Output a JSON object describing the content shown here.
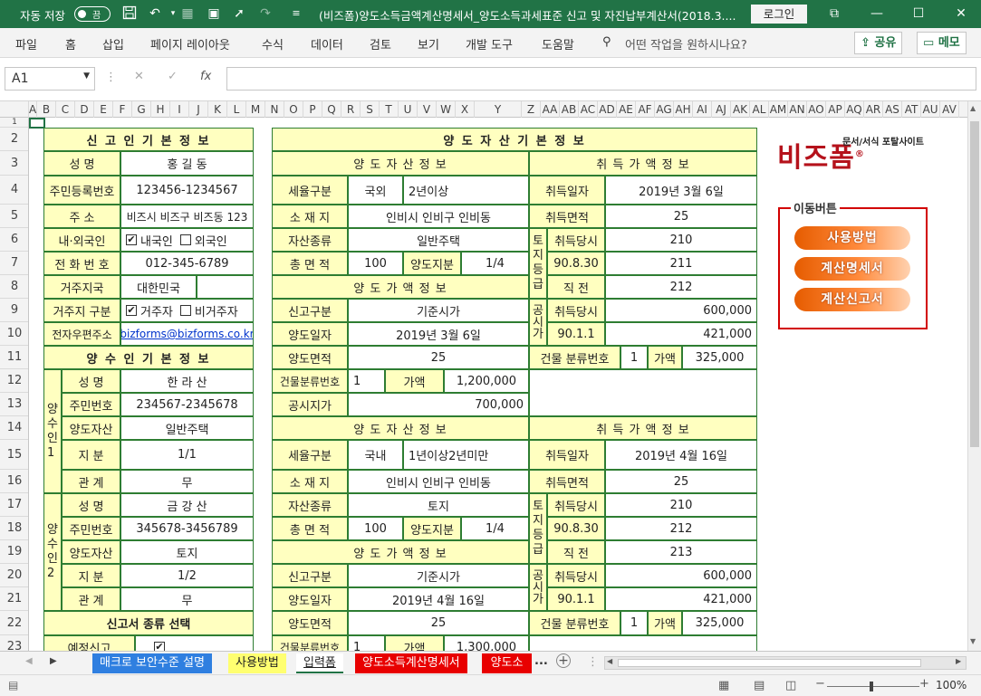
{
  "titlebar": {
    "autosave_label": "자동 저장",
    "autosave_state": "끔",
    "doc_title": "(비즈폼)양도소득금액계산명세서_양도소득과세표준 신고 및 자진납부계산서(2018.3....",
    "login_label": "로그인"
  },
  "ribbon": {
    "tabs": [
      "파일",
      "홈",
      "삽입",
      "페이지 레이아웃",
      "수식",
      "데이터",
      "검토",
      "보기",
      "개발 도구",
      "도움말"
    ],
    "tell_me": "어떤 작업을 원하시나요?",
    "share_label": "공유",
    "comment_label": "메모"
  },
  "formula_bar": {
    "name_box": "A1",
    "fx": "fx",
    "formula": ""
  },
  "columns": [
    "A",
    "B",
    "C",
    "D",
    "E",
    "F",
    "G",
    "H",
    "I",
    "J",
    "K",
    "L",
    "M",
    "N",
    "O",
    "P",
    "Q",
    "R",
    "S",
    "T",
    "U",
    "V",
    "W",
    "X",
    "Y",
    "Z",
    "AA",
    "AB",
    "AC",
    "AD",
    "AE",
    "AF",
    "AG",
    "AH",
    "AI",
    "AJ",
    "AK",
    "AL",
    "AM",
    "AN",
    "AO",
    "AP",
    "AQ",
    "AR",
    "AS",
    "AT",
    "AU",
    "AV"
  ],
  "rows": [
    "1",
    "2",
    "3",
    "4",
    "5",
    "6",
    "7",
    "8",
    "9",
    "10",
    "11",
    "12",
    "13",
    "14",
    "15",
    "16",
    "17",
    "18",
    "19",
    "20",
    "21",
    "22",
    "23"
  ],
  "left": {
    "reporter_title": "신 고 인 기 본 정 보",
    "name_label": "성 명",
    "name_value": "홍 길 동",
    "rrn_label": "주민등록번호",
    "rrn_value": "123456-1234567",
    "addr_label": "주 소",
    "addr_value": "비즈시 비즈구 비즈동 123",
    "nat_label": "내·외국인",
    "nat_opt1": "내국인",
    "nat_opt2": "외국인",
    "nat_check": "✔",
    "tel_label": "전 화 번 호",
    "tel_value": "012-345-6789",
    "country_label": "거주지국",
    "country_value": "대한민국",
    "res_label": "거주지 구분",
    "res_opt1": "거주자",
    "res_opt2": "비거주자",
    "res_check": "✔",
    "email_label": "전자우편주소",
    "email_value": "bizforms@bizforms.co.kr",
    "transferee_title": "양 수 인 기 본 정 보",
    "t1_side": "양수인1",
    "t1_name_label": "성 명",
    "t1_name": "한 라 산",
    "t1_rrn_label": "주민번호",
    "t1_rrn": "234567-2345678",
    "t1_asset_label": "양도자산",
    "t1_asset": "일반주택",
    "t1_share_label": "지 분",
    "t1_share": "1/1",
    "t1_rel_label": "관 계",
    "t1_rel": "무",
    "t2_side": "양수인2",
    "t2_name_label": "성 명",
    "t2_name": "금 강 산",
    "t2_rrn_label": "주민번호",
    "t2_rrn": "345678-3456789",
    "t2_asset_label": "양도자산",
    "t2_asset": "토지",
    "t2_share_label": "지 분",
    "t2_share": "1/2",
    "t2_rel_label": "관 계",
    "t2_rel": "무",
    "type_title": "신고서 종류 선택",
    "prelim_label": "예정신고",
    "prelim_check": "✔"
  },
  "main": {
    "title": "양 도 자 산 기 본 정 보",
    "asset_info_label": "양 도 자 산 정 보",
    "acq_info_label": "취 득 가 액 정 보",
    "price_info_label": "양 도 가 액 정 보",
    "tax_type_label": "세율구분",
    "location_label": "소 재 지",
    "asset_type_label": "자산종류",
    "area_label": "총 면 적",
    "share_label": "양도지분",
    "report_type_label": "신고구분",
    "transfer_date_label": "양도일자",
    "transfer_area_label": "양도면적",
    "bldg_class_label": "건물분류번호",
    "price_label": "가액",
    "land_price_label": "공시지가",
    "acq_date_label": "취득일자",
    "acq_area_label": "취득면적",
    "land_grade_side": "토지등급",
    "notice_side": "공시가",
    "acq_time_label": "취득당시",
    "direct_before_label": "직 전",
    "bldg_class2_label": "건물 분류번호",
    "a1": {
      "tax_type": "국외",
      "holding": "2년이상",
      "location": "인비시 인비구 인비동",
      "asset_type": "일반주택",
      "area": "100",
      "share": "1/4",
      "report_type": "기준시가",
      "transfer_date": "2019년 3월 6일",
      "transfer_area": "25",
      "bldg_class": "1",
      "bldg_price": "1,200,000",
      "land_price": "700,000",
      "acq_date": "2019년 3월 6일",
      "acq_area": "25",
      "grade_acq": "210",
      "grade_date": "90.8.30",
      "grade_date_val": "211",
      "grade_direct": "212",
      "notice_acq": "600,000",
      "notice_date": "90.1.1",
      "notice_date_val": "421,000",
      "bldg_class2": "1",
      "bldg_price2": "325,000"
    },
    "a2": {
      "tax_type": "국내",
      "holding": "1년이상2년미만",
      "location": "인비시 인비구 인비동",
      "asset_type": "토지",
      "area": "100",
      "share": "1/4",
      "report_type": "기준시가",
      "transfer_date": "2019년 4월 16일",
      "transfer_area": "25",
      "bldg_class": "1",
      "bldg_price": "1,300,000",
      "acq_date": "2019년 4월 16일",
      "acq_area": "25",
      "grade_acq": "210",
      "grade_date": "90.8.30",
      "grade_date_val": "212",
      "grade_direct": "213",
      "notice_acq": "600,000",
      "notice_date": "90.1.1",
      "notice_date_val": "421,000",
      "bldg_class2": "1",
      "bldg_price2": "325,000"
    }
  },
  "side": {
    "logo_text": "비즈폼",
    "logo_sub": "문서/서식 포탈사이트",
    "move_label": "이동버튼",
    "btn_usage": "사용방법",
    "btn_detail": "계산명세서",
    "btn_report": "계산신고서"
  },
  "sheet_tabs": {
    "tabs": [
      "매크로 보안수준 설명",
      "사용방법",
      "입력폼",
      "양도소득계산명세서",
      "양도소"
    ],
    "more": "..."
  },
  "status": {
    "zoom": "100%"
  }
}
